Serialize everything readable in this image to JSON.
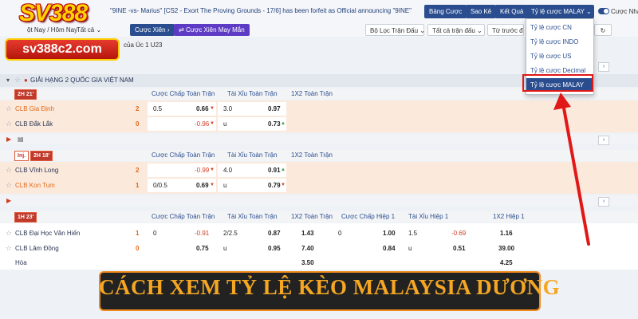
{
  "logo": {
    "brand": "SV388",
    "url": "sv388c2.com"
  },
  "topbar": {
    "ticker": "\"9INE -vs- Marius\" [CS2 - Exort The Proving Grounds - 17/6] has been forfeit as Official announcing \"9INE\" as",
    "buttons": [
      "Bảng Cược",
      "Sao Kê",
      "Kết Quả"
    ],
    "odds_dropdown": "Tỷ lệ cược MALAY",
    "toggle_label": "Cược Nha"
  },
  "filters": {
    "date_select": "ột Nay / Hôm Nay",
    "sport_select": "Tất cả",
    "bet_chip": "Cược Xiên",
    "lucky_chip": "Cược Xiên May Mắn",
    "match_filter": "Bộ Lọc Trận Đấu",
    "all_matches": "Tất cả trận đấu",
    "time_sort": "Từ trước đến"
  },
  "subline": "của Úc 1 U23",
  "odds_menu": {
    "options": [
      "Tỷ lệ cược CN",
      "Tỷ lệ cược INDO",
      "Tỷ lệ cược US",
      "Tỷ lệ cược Decimal",
      "Tỷ lệ cược MALAY"
    ],
    "selected_index": 4
  },
  "league": {
    "name": "GIẢI HẠNG 2 QUỐC GIA VIỆT NAM"
  },
  "columns": {
    "handicap": "Cược Chấp Toàn Trận",
    "overunder": "Tài Xỉu Toàn Trận",
    "x12": "1X2 Toàn Trận",
    "handicap_h1": "Cược Chấp Hiệp 1",
    "overunder_h1": "Tài Xỉu Hiệp 1",
    "x12_h1": "1X2 Hiệp 1"
  },
  "matches": [
    {
      "time": "2H 21'",
      "home": {
        "name": "CLB Gia Định",
        "score": "2",
        "hdp_line": "0.5",
        "hdp_odds": "0.66",
        "ou_line": "3.0",
        "ou_odds": "0.97"
      },
      "away": {
        "name": "CLB Đắk Lắk",
        "score": "0",
        "hdp_odds": "-0.96",
        "ou_line": "u",
        "ou_odds": "0.73"
      }
    },
    {
      "inj": "Inj.",
      "time": "2H 18'",
      "home": {
        "name": "CLB Vĩnh Long",
        "score": "2",
        "hdp_odds": "-0.99",
        "ou_line": "4.0",
        "ou_odds": "0.91"
      },
      "away": {
        "name": "CLB Kon Tum",
        "score": "1",
        "hdp_line": "0/0.5",
        "hdp_odds": "0.69",
        "ou_line": "u",
        "ou_odds": "0.79"
      }
    },
    {
      "time": "1H 23'",
      "home": {
        "name": "CLB Đại Học Văn Hiến",
        "score": "1",
        "hdp_line": "0",
        "hdp_odds": "-0.91",
        "ou_line": "2/2.5",
        "ou_odds": "0.87",
        "x12": "1.43",
        "hdp1_line": "0",
        "hdp1_odds": "1.00",
        "ou1_line": "1.5",
        "ou1_odds": "-0.69",
        "x121": "1.16"
      },
      "away": {
        "name": "CLB Lâm Đồng",
        "score": "0",
        "hdp_odds": "0.75",
        "ou_line": "u",
        "ou_odds": "0.95",
        "x12": "7.40",
        "hdp1_odds": "0.84",
        "ou1_line": "u",
        "ou1_odds": "0.51",
        "x121": "39.00"
      },
      "draw": {
        "label": "Hòa",
        "x12": "3.50",
        "x121": "4.25"
      }
    }
  ],
  "banner": {
    "text": "CÁCH XEM TỶ LỆ KÈO MALAYSIA DƯƠNG"
  },
  "colors": {
    "accent": "#2a4d8f",
    "highlight_row": "#fbe9dc",
    "negative": "#d23b1f",
    "banner_text": "#f5a623",
    "callout": "#e01818"
  }
}
